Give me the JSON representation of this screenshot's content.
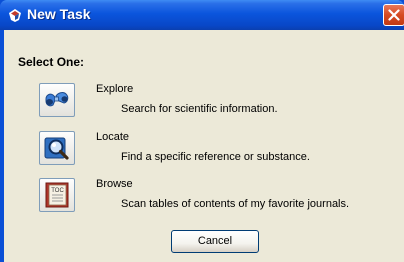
{
  "window": {
    "title": "New Task"
  },
  "dialog": {
    "heading": "Select One:",
    "options": [
      {
        "title": "Explore",
        "description": "Search for scientific information.",
        "icon": "binoculars-icon"
      },
      {
        "title": "Locate",
        "description": "Find a specific reference or substance.",
        "icon": "magnifier-icon"
      },
      {
        "title": "Browse",
        "description": "Scan tables of contents of my favorite journals.",
        "icon": "toc-book-icon",
        "icon_text": "TOC"
      }
    ],
    "cancel_label": "Cancel"
  },
  "colors": {
    "titlebar": "#0b55dd",
    "client": "#ece9d8",
    "close": "#d64a22"
  }
}
